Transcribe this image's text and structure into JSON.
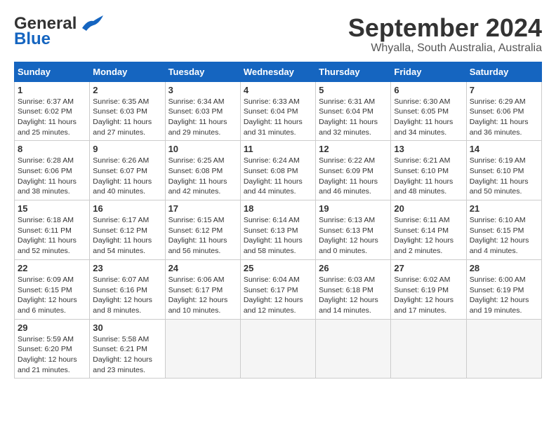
{
  "header": {
    "logo_line1": "General",
    "logo_line2": "Blue",
    "title": "September 2024",
    "subtitle": "Whyalla, South Australia, Australia"
  },
  "calendar": {
    "days_of_week": [
      "Sunday",
      "Monday",
      "Tuesday",
      "Wednesday",
      "Thursday",
      "Friday",
      "Saturday"
    ],
    "weeks": [
      [
        {
          "day": "1",
          "info": "Sunrise: 6:37 AM\nSunset: 6:02 PM\nDaylight: 11 hours\nand 25 minutes."
        },
        {
          "day": "2",
          "info": "Sunrise: 6:35 AM\nSunset: 6:03 PM\nDaylight: 11 hours\nand 27 minutes."
        },
        {
          "day": "3",
          "info": "Sunrise: 6:34 AM\nSunset: 6:03 PM\nDaylight: 11 hours\nand 29 minutes."
        },
        {
          "day": "4",
          "info": "Sunrise: 6:33 AM\nSunset: 6:04 PM\nDaylight: 11 hours\nand 31 minutes."
        },
        {
          "day": "5",
          "info": "Sunrise: 6:31 AM\nSunset: 6:04 PM\nDaylight: 11 hours\nand 32 minutes."
        },
        {
          "day": "6",
          "info": "Sunrise: 6:30 AM\nSunset: 6:05 PM\nDaylight: 11 hours\nand 34 minutes."
        },
        {
          "day": "7",
          "info": "Sunrise: 6:29 AM\nSunset: 6:06 PM\nDaylight: 11 hours\nand 36 minutes."
        }
      ],
      [
        {
          "day": "8",
          "info": "Sunrise: 6:28 AM\nSunset: 6:06 PM\nDaylight: 11 hours\nand 38 minutes."
        },
        {
          "day": "9",
          "info": "Sunrise: 6:26 AM\nSunset: 6:07 PM\nDaylight: 11 hours\nand 40 minutes."
        },
        {
          "day": "10",
          "info": "Sunrise: 6:25 AM\nSunset: 6:08 PM\nDaylight: 11 hours\nand 42 minutes."
        },
        {
          "day": "11",
          "info": "Sunrise: 6:24 AM\nSunset: 6:08 PM\nDaylight: 11 hours\nand 44 minutes."
        },
        {
          "day": "12",
          "info": "Sunrise: 6:22 AM\nSunset: 6:09 PM\nDaylight: 11 hours\nand 46 minutes."
        },
        {
          "day": "13",
          "info": "Sunrise: 6:21 AM\nSunset: 6:10 PM\nDaylight: 11 hours\nand 48 minutes."
        },
        {
          "day": "14",
          "info": "Sunrise: 6:19 AM\nSunset: 6:10 PM\nDaylight: 11 hours\nand 50 minutes."
        }
      ],
      [
        {
          "day": "15",
          "info": "Sunrise: 6:18 AM\nSunset: 6:11 PM\nDaylight: 11 hours\nand 52 minutes."
        },
        {
          "day": "16",
          "info": "Sunrise: 6:17 AM\nSunset: 6:12 PM\nDaylight: 11 hours\nand 54 minutes."
        },
        {
          "day": "17",
          "info": "Sunrise: 6:15 AM\nSunset: 6:12 PM\nDaylight: 11 hours\nand 56 minutes."
        },
        {
          "day": "18",
          "info": "Sunrise: 6:14 AM\nSunset: 6:13 PM\nDaylight: 11 hours\nand 58 minutes."
        },
        {
          "day": "19",
          "info": "Sunrise: 6:13 AM\nSunset: 6:13 PM\nDaylight: 12 hours\nand 0 minutes."
        },
        {
          "day": "20",
          "info": "Sunrise: 6:11 AM\nSunset: 6:14 PM\nDaylight: 12 hours\nand 2 minutes."
        },
        {
          "day": "21",
          "info": "Sunrise: 6:10 AM\nSunset: 6:15 PM\nDaylight: 12 hours\nand 4 minutes."
        }
      ],
      [
        {
          "day": "22",
          "info": "Sunrise: 6:09 AM\nSunset: 6:15 PM\nDaylight: 12 hours\nand 6 minutes."
        },
        {
          "day": "23",
          "info": "Sunrise: 6:07 AM\nSunset: 6:16 PM\nDaylight: 12 hours\nand 8 minutes."
        },
        {
          "day": "24",
          "info": "Sunrise: 6:06 AM\nSunset: 6:17 PM\nDaylight: 12 hours\nand 10 minutes."
        },
        {
          "day": "25",
          "info": "Sunrise: 6:04 AM\nSunset: 6:17 PM\nDaylight: 12 hours\nand 12 minutes."
        },
        {
          "day": "26",
          "info": "Sunrise: 6:03 AM\nSunset: 6:18 PM\nDaylight: 12 hours\nand 14 minutes."
        },
        {
          "day": "27",
          "info": "Sunrise: 6:02 AM\nSunset: 6:19 PM\nDaylight: 12 hours\nand 17 minutes."
        },
        {
          "day": "28",
          "info": "Sunrise: 6:00 AM\nSunset: 6:19 PM\nDaylight: 12 hours\nand 19 minutes."
        }
      ],
      [
        {
          "day": "29",
          "info": "Sunrise: 5:59 AM\nSunset: 6:20 PM\nDaylight: 12 hours\nand 21 minutes."
        },
        {
          "day": "30",
          "info": "Sunrise: 5:58 AM\nSunset: 6:21 PM\nDaylight: 12 hours\nand 23 minutes."
        },
        {
          "day": "",
          "info": ""
        },
        {
          "day": "",
          "info": ""
        },
        {
          "day": "",
          "info": ""
        },
        {
          "day": "",
          "info": ""
        },
        {
          "day": "",
          "info": ""
        }
      ]
    ]
  }
}
